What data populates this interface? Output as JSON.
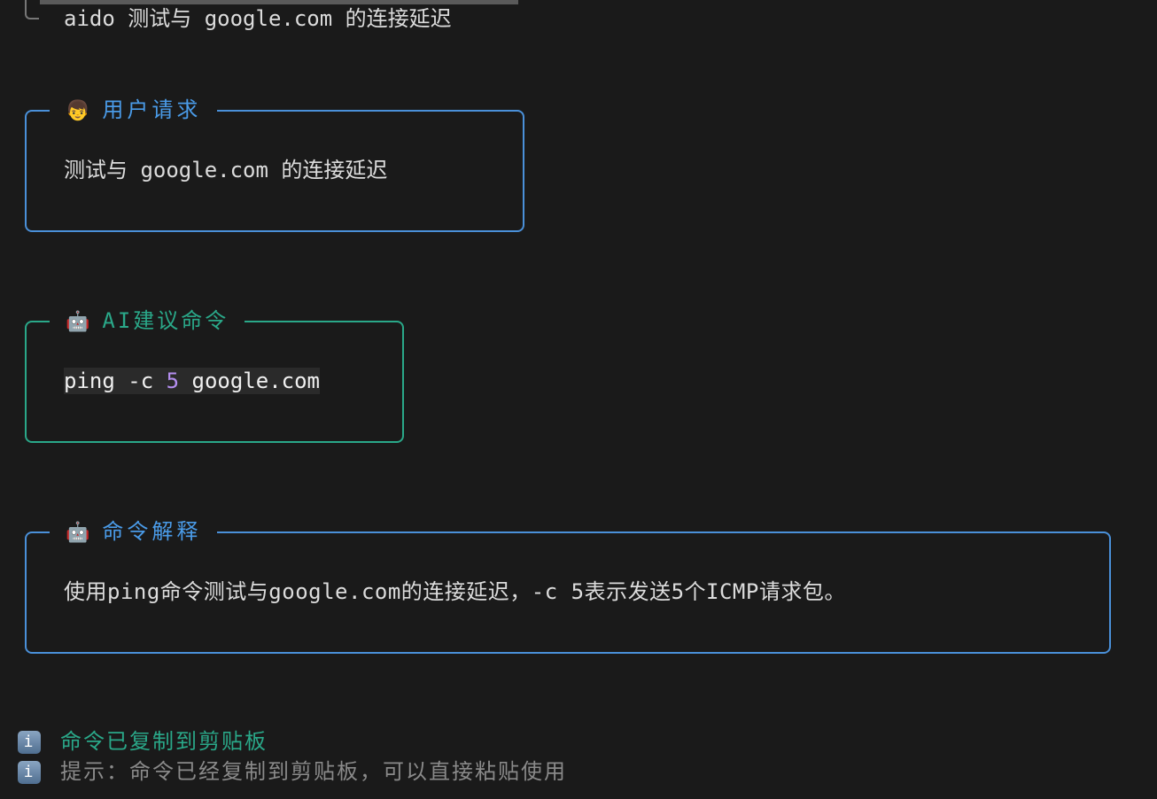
{
  "prompt_line": "aido 测试与 google.com 的连接延迟",
  "user_request": {
    "icon": "person-emoji",
    "title": "用户请求",
    "text": "测试与 google.com 的连接延迟"
  },
  "ai_command": {
    "icon": "robot-emoji",
    "title": "AI建议命令",
    "cmd_pre": "ping -c ",
    "cmd_num": "5",
    "cmd_post": " google.com"
  },
  "explanation": {
    "icon": "robot-emoji",
    "title": "命令解释",
    "text": "使用ping命令测试与google.com的连接延迟，-c 5表示发送5个ICMP请求包。"
  },
  "messages": [
    {
      "icon": "info-icon",
      "text": "命令已复制到剪贴板",
      "color": "#2aa889"
    },
    {
      "icon": "info-icon",
      "text": "提示：命令已经复制到剪贴板，可以直接粘贴使用",
      "color": "#8a8a8a"
    }
  ]
}
